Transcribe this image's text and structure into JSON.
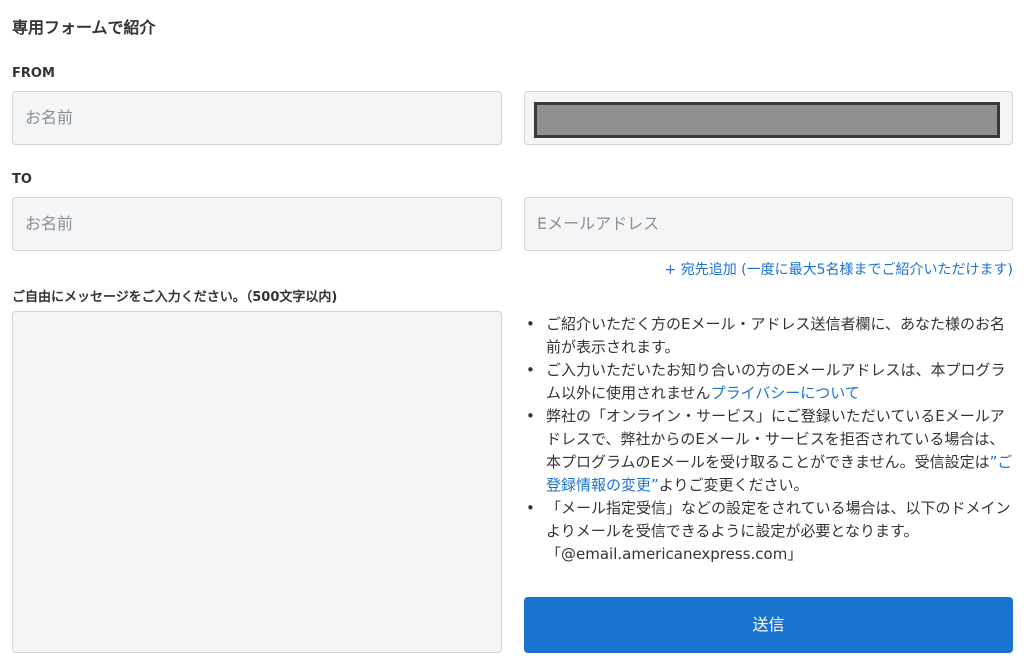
{
  "page_title": "専用フォームで紹介",
  "from": {
    "label": "FROM",
    "name_placeholder": "お名前"
  },
  "to": {
    "label": "TO",
    "name_placeholder": "お名前",
    "email_placeholder": "Eメールアドレス",
    "add_link": "+ 宛先追加 (一度に最大5名様までご紹介いただけます)"
  },
  "message": {
    "label": "ご自由にメッセージをご入力ください。（500文字以内)"
  },
  "notes": [
    {
      "text": "ご紹介いただく方のEメール・アドレス送信者欄に、あなた様のお名前が表示されます。"
    },
    {
      "text": "ご入力いただいたお知り合いの方のEメールアドレスは、本プログラム以外に使用されません",
      "link": "プライバシーについて"
    },
    {
      "text": "弊社の「オンライン・サービス」にご登録いただいているEメールアドレスで、弊社からのEメール・サービスを拒否されている場合は、本プログラムのEメールを受け取ることができません。受信設定は",
      "link": "”ご登録情報の変更”",
      "text_after": "よりご変更ください。"
    },
    {
      "text": "「メール指定受信」などの設定をされている場合は、以下のドメインよりメールを受信できるように設定が必要となります。「@email.americanexpress.com」"
    }
  ],
  "submit_label": "送信",
  "colors": {
    "accent": "#1a73cf",
    "link": "#1b72d4",
    "field_bg": "#f4f5f6",
    "redaction": "#8f8f8f"
  }
}
